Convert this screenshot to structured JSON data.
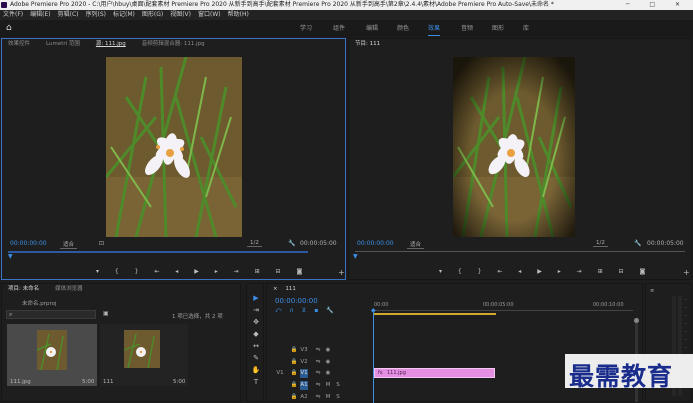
{
  "titlebar": {
    "title": "Adobe Premiere Pro 2020 - C:\\用户\\hbuy\\桌面\\配套素材 Premiere Pro 2020 从新手到高手\\配套素材 Premiere Pro 2020 从新手到高手\\第2章\\2.4.4\\素材\\Adobe Premiere Pro Auto-Save\\未命名 *"
  },
  "menubar": {
    "items": [
      "文件(F)",
      "编辑(E)",
      "剪辑(C)",
      "序列(S)",
      "标记(M)",
      "图形(G)",
      "视图(V)",
      "窗口(W)",
      "帮助(H)"
    ]
  },
  "workspaces": {
    "items": [
      "学习",
      "组件",
      "编辑",
      "颜色",
      "效果",
      "音频",
      "图形",
      "库"
    ],
    "active": "效果"
  },
  "source_panel": {
    "tabs": [
      "效果控件",
      "Lumetri 范围",
      "源: 111.jpg",
      "音频剪辑混合器: 111.jpg"
    ],
    "timecode_left": "00:00:00:00",
    "fit": "适合",
    "ratio": "1/2",
    "timecode_right": "00:00:05:00"
  },
  "program_panel": {
    "tabs": [
      "节目: 111"
    ],
    "timecode_left": "00:00:00:00",
    "fit": "适合",
    "ratio": "1/2",
    "timecode_right": "00:00:05:00"
  },
  "project_panel": {
    "tabs": [
      "项目: 未命名",
      "媒体浏览器"
    ],
    "filename": "未命名.prproj",
    "selection_info": "1 项已选择，共 2 项",
    "items": [
      {
        "name": "111.jpg",
        "duration": "5:00"
      },
      {
        "name": "111",
        "duration": "5:00"
      }
    ]
  },
  "timeline": {
    "sequence_tab": "111",
    "timecode": "00:00:00:00",
    "ruler": [
      "00:00",
      "00:00:05:00",
      "00:00:10:00"
    ],
    "tracks": [
      {
        "id": "V3",
        "type": "video"
      },
      {
        "id": "V2",
        "type": "video"
      },
      {
        "id": "V1",
        "type": "video",
        "source": "V1"
      },
      {
        "id": "A1",
        "type": "audio",
        "source": "A1"
      },
      {
        "id": "A2",
        "type": "audio"
      }
    ],
    "clip": {
      "name": "111.jpg",
      "color": "#e58fe3"
    }
  },
  "watermark": {
    "text": "最需教育"
  },
  "colors": {
    "accent": "#3d8fe8",
    "clip": "#e58fe3",
    "panel_focus": "#3d73c5"
  }
}
